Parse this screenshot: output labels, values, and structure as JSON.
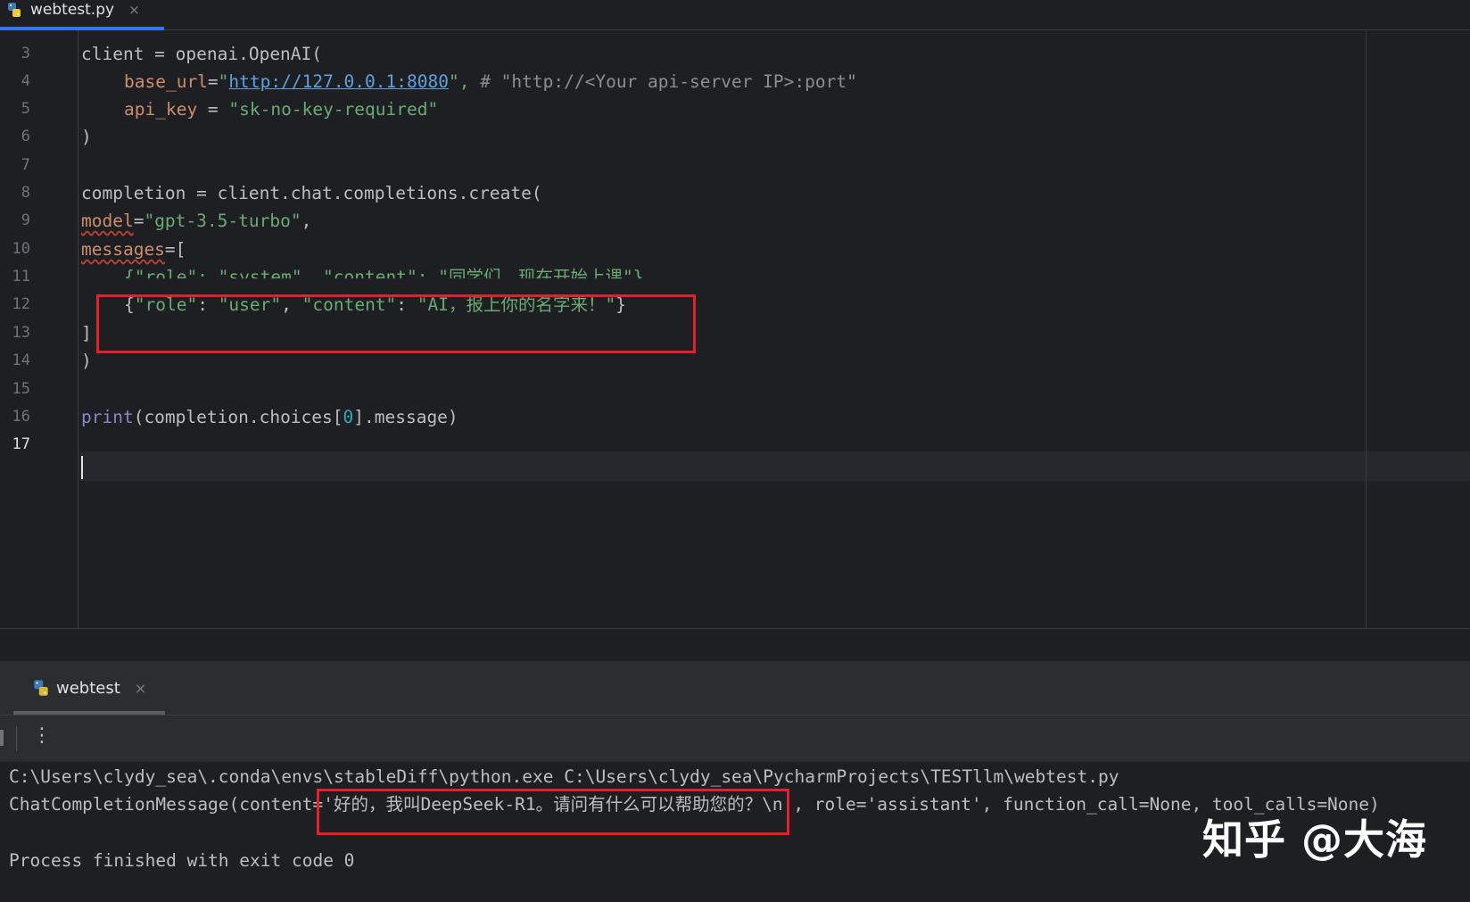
{
  "editor_tab": {
    "filename": "webtest.py",
    "close_glyph": "×"
  },
  "line_numbers": [
    "3",
    "4",
    "5",
    "6",
    "7",
    "8",
    "9",
    "10",
    "11",
    "12",
    "13",
    "14",
    "15",
    "16",
    "17"
  ],
  "code": {
    "l3": "client = openai.OpenAI(",
    "l4_param": "base_url",
    "l4_eq": "=",
    "l4_url": "http://127.0.0.1:8080",
    "l4_rest": "\",",
    "l4_comment": " # \"http://<Your api-server IP>:port\"",
    "l5_param": "api_key",
    "l5_eq": " = ",
    "l5_str": "\"sk-no-key-required\"",
    "l6": ")",
    "l8": "completion = client.chat.completions.create(",
    "l9_param": "model",
    "l9_eq": "=",
    "l9_str": "\"gpt-3.5-turbo\"",
    "l9_comma": ",",
    "l10_param": "messages",
    "l10_rest": "=[",
    "l11": "{\"role\": \"system\", \"content\": \"同学们，现在开始上课\"},",
    "l12_open": "{",
    "l12_k1": "\"role\"",
    "l12_c1": ": ",
    "l12_v1": "\"user\"",
    "l12_c2": ", ",
    "l12_k2": "\"content\"",
    "l12_c3": ": ",
    "l12_v2": "\"AI，报上你的名字来！\"",
    "l12_close": "}",
    "l13": "]",
    "l14": ")",
    "l16_fn": "print",
    "l16_a": "(completion.choices[",
    "l16_num": "0",
    "l16_b": "].message)"
  },
  "run_panel": {
    "tab_label": "webtest",
    "close_glyph": "×",
    "more_glyph": "⋮"
  },
  "console": {
    "command": "C:\\Users\\clydy_sea\\.conda\\envs\\stableDiff\\python.exe C:\\Users\\clydy_sea\\PycharmProjects\\TESTllm\\webtest.py",
    "output_prefix": "ChatCompletionMessage(content='",
    "output_highlight": "好的，我叫DeepSeek-R1。请问有什么可以帮助您的？\\n",
    "output_suffix": "', role='assistant', function_call=None, tool_calls=None)",
    "exit_message": "Process finished with exit code 0"
  },
  "watermark": "知乎 @大海",
  "colors": {
    "background": "#1e1f22",
    "string": "#6aab73",
    "param": "#ce8e6d",
    "highlight_box": "#e5202a",
    "tab_accent": "#3574f0"
  }
}
